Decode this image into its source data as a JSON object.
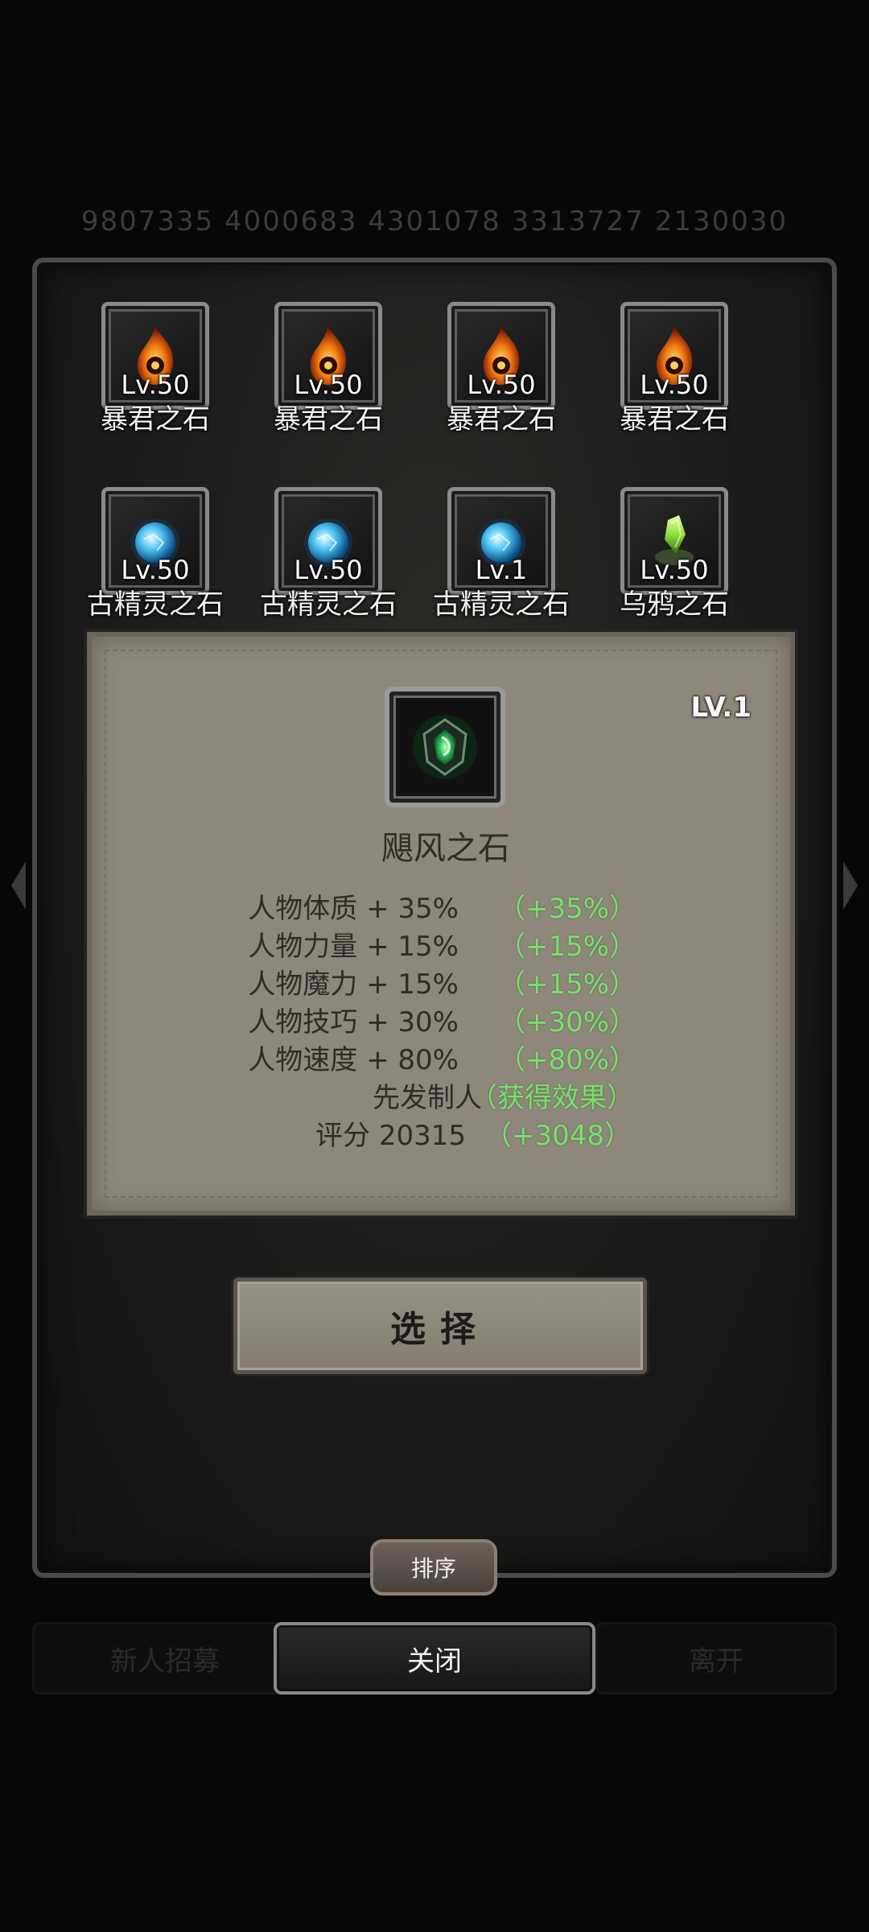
{
  "background": {
    "faint_stats": "9807335  4000683  4301078  3313727  2130030"
  },
  "stones": [
    {
      "level": "Lv.50",
      "name": "暴君之石",
      "icon": "fire-stone-icon"
    },
    {
      "level": "Lv.50",
      "name": "暴君之石",
      "icon": "fire-stone-icon"
    },
    {
      "level": "Lv.50",
      "name": "暴君之石",
      "icon": "fire-stone-icon"
    },
    {
      "level": "Lv.50",
      "name": "暴君之石",
      "icon": "fire-stone-icon"
    },
    {
      "level": "Lv.50",
      "name": "古精灵之石",
      "icon": "blue-orb-icon"
    },
    {
      "level": "Lv.50",
      "name": "古精灵之石",
      "icon": "blue-orb-icon"
    },
    {
      "level": "Lv.1",
      "name": "古精灵之石",
      "icon": "blue-orb-icon"
    },
    {
      "level": "Lv.50",
      "name": "乌鸦之石",
      "icon": "green-crystal-icon"
    }
  ],
  "detail": {
    "level": "LV.1",
    "name": "飓风之石",
    "icon": "green-gem-icon",
    "stats": [
      {
        "label": "人物体质 + 35%",
        "bonus": "（+35%）"
      },
      {
        "label": "人物力量 + 15%",
        "bonus": "（+15%）"
      },
      {
        "label": "人物魔力 + 15%",
        "bonus": "（+15%）"
      },
      {
        "label": "人物技巧 + 30%",
        "bonus": "（+30%）"
      },
      {
        "label": "人物速度 + 80%",
        "bonus": "（+80%）"
      },
      {
        "label": "先发制人",
        "bonus": "（获得效果）"
      },
      {
        "label": "评分 20315",
        "bonus": "（+3048）"
      }
    ]
  },
  "buttons": {
    "select": "选择",
    "sort": "排序",
    "close": "关闭",
    "recruit": "新人招募",
    "leave": "离开"
  },
  "colors": {
    "bonus_green": "#7dde6f",
    "card_bg": "#8f877b"
  }
}
